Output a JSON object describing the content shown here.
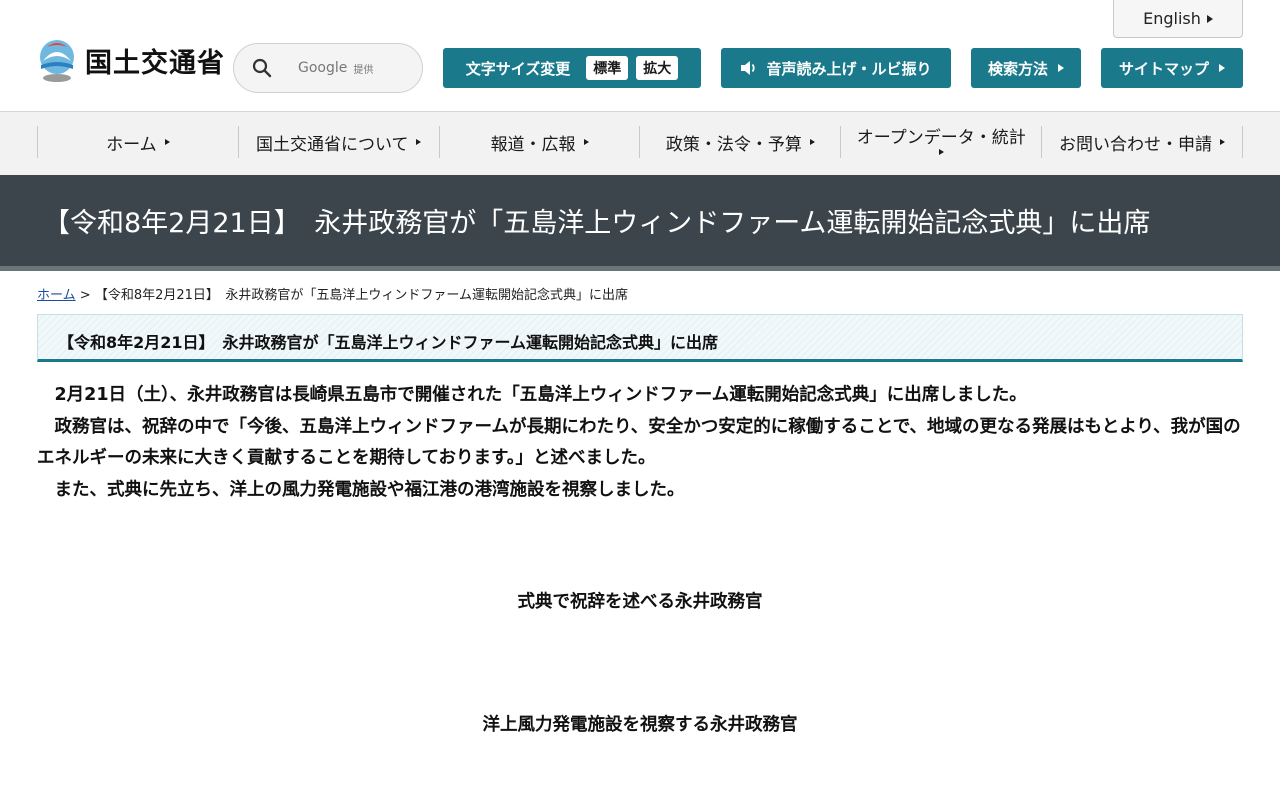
{
  "header": {
    "english_label": "English",
    "logo_text": "国土交通省",
    "search": {
      "provider": "Google",
      "provided_by": "提供"
    },
    "font_size": {
      "label": "文字サイズ変更",
      "standard": "標準",
      "large": "拡大"
    },
    "speech_label": "音声読み上げ・ルビ振り",
    "search_method_label": "検索方法",
    "sitemap_label": "サイトマップ",
    "accent_color": "#1a7a8c"
  },
  "nav": {
    "items": [
      {
        "label": "ホーム"
      },
      {
        "label": "国土交通省について"
      },
      {
        "label": "報道・広報"
      },
      {
        "label": "政策・法令・予算"
      },
      {
        "label": "オープンデータ・統計"
      },
      {
        "label": "お問い合わせ・申請"
      }
    ]
  },
  "banner": {
    "title": "【令和8年2月21日】　永井政務官が「五島洋上ウィンドファーム運転開始記念式典」に出席",
    "bg_color": "#3b454b"
  },
  "breadcrumb": {
    "home": "ホーム",
    "separator": ">",
    "current": "【令和8年2月21日】　永井政務官が「五島洋上ウィンドファーム運転開始記念式典」に出席"
  },
  "article": {
    "heading": "【令和8年2月21日】　永井政務官が「五島洋上ウィンドファーム運転開始記念式典」に出席",
    "paragraphs": [
      "　2月21日（土）、永井政務官は長崎県五島市で開催された「五島洋上ウィンドファーム運転開始記念式典」に出席しました。",
      "　政務官は、祝辞の中で「今後、五島洋上ウィンドファームが長期にわたり、安全かつ安定的に稼働することで、地域の更なる発展はもとより、我が国のエネルギーの未来に大きく貢献することを期待しております。」と述べました。",
      "　また、式典に先立ち、洋上の風力発電施設や福江港の港湾施設を視察しました。"
    ],
    "captions": [
      "式典で祝辞を述べる永井政務官",
      "洋上風力発電施設を視察する永井政務官"
    ]
  }
}
